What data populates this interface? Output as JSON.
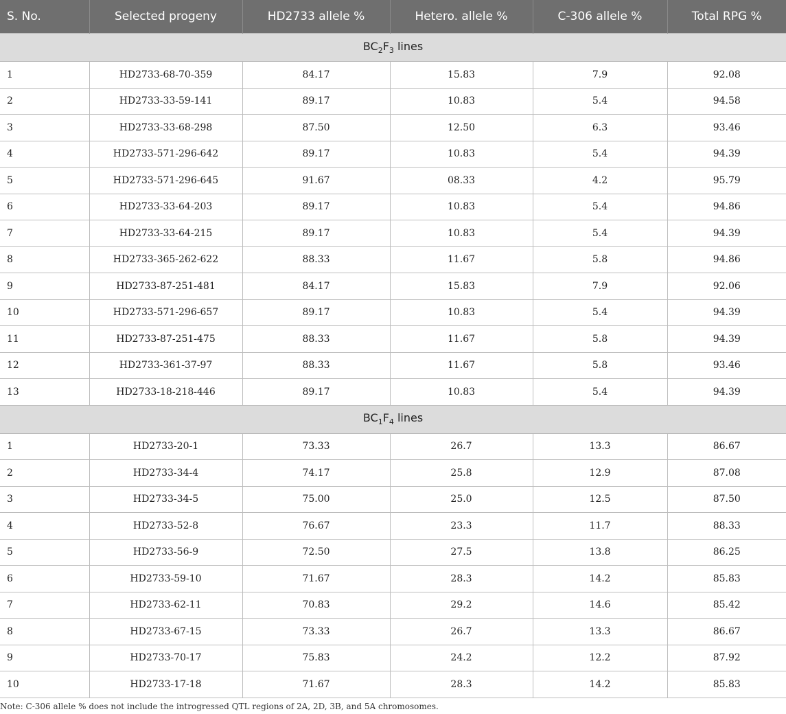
{
  "headers": [
    "S. No.",
    "Selected progeny",
    "HD2733 allele %",
    "Hetero. allele %",
    "C-306 allele %",
    "Total RPG %"
  ],
  "sections": [
    {
      "title_prefix": "BC",
      "title_sub1": "2",
      "title_mid": "F",
      "title_sub2": "3",
      "title_suffix": " lines",
      "rows": [
        [
          "1",
          "HD2733-68-70-359",
          "84.17",
          "15.83",
          "7.9",
          "92.08"
        ],
        [
          "2",
          "HD2733-33-59-141",
          "89.17",
          "10.83",
          "5.4",
          "94.58"
        ],
        [
          "3",
          "HD2733-33-68-298",
          "87.50",
          "12.50",
          "6.3",
          "93.46"
        ],
        [
          "4",
          "HD2733-571-296-642",
          "89.17",
          "10.83",
          "5.4",
          "94.39"
        ],
        [
          "5",
          "HD2733-571-296-645",
          "91.67",
          "08.33",
          "4.2",
          "95.79"
        ],
        [
          "6",
          "HD2733-33-64-203",
          "89.17",
          "10.83",
          "5.4",
          "94.86"
        ],
        [
          "7",
          "HD2733-33-64-215",
          "89.17",
          "10.83",
          "5.4",
          "94.39"
        ],
        [
          "8",
          "HD2733-365-262-622",
          "88.33",
          "11.67",
          "5.8",
          "94.86"
        ],
        [
          "9",
          "HD2733-87-251-481",
          "84.17",
          "15.83",
          "7.9",
          "92.06"
        ],
        [
          "10",
          "HD2733-571-296-657",
          "89.17",
          "10.83",
          "5.4",
          "94.39"
        ],
        [
          "11",
          "HD2733-87-251-475",
          "88.33",
          "11.67",
          "5.8",
          "94.39"
        ],
        [
          "12",
          "HD2733-361-37-97",
          "88.33",
          "11.67",
          "5.8",
          "93.46"
        ],
        [
          "13",
          "HD2733-18-218-446",
          "89.17",
          "10.83",
          "5.4",
          "94.39"
        ]
      ]
    },
    {
      "title_prefix": "BC",
      "title_sub1": "1",
      "title_mid": "F",
      "title_sub2": "4",
      "title_suffix": " lines",
      "rows": [
        [
          "1",
          "HD2733-20-1",
          "73.33",
          "26.7",
          "13.3",
          "86.67"
        ],
        [
          "2",
          "HD2733-34-4",
          "74.17",
          "25.8",
          "12.9",
          "87.08"
        ],
        [
          "3",
          "HD2733-34-5",
          "75.00",
          "25.0",
          "12.5",
          "87.50"
        ],
        [
          "4",
          "HD2733-52-8",
          "76.67",
          "23.3",
          "11.7",
          "88.33"
        ],
        [
          "5",
          "HD2733-56-9",
          "72.50",
          "27.5",
          "13.8",
          "86.25"
        ],
        [
          "6",
          "HD2733-59-10",
          "71.67",
          "28.3",
          "14.2",
          "85.83"
        ],
        [
          "7",
          "HD2733-62-11",
          "70.83",
          "29.2",
          "14.6",
          "85.42"
        ],
        [
          "8",
          "HD2733-67-15",
          "73.33",
          "26.7",
          "13.3",
          "86.67"
        ],
        [
          "9",
          "HD2733-70-17",
          "75.83",
          "24.2",
          "12.2",
          "87.92"
        ],
        [
          "10",
          "HD2733-17-18",
          "71.67",
          "28.3",
          "14.2",
          "85.83"
        ]
      ]
    }
  ],
  "note": "Note: C-306 allele % does not include the introgressed QTL regions of 2A, 2D, 3B, and 5A chromosomes."
}
